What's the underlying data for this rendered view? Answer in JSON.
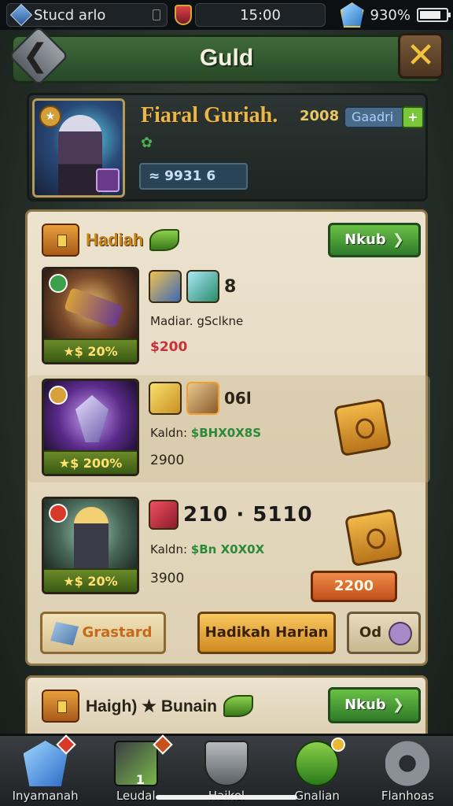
{
  "status_bar": {
    "left_text": "Stucd arlo",
    "time": "15:00",
    "battery_text": "930%",
    "battery_level_pct": 80
  },
  "header": {
    "title": "Guld",
    "back_icon": "chevron-left-icon",
    "close_icon": "close-icon"
  },
  "profile": {
    "name": "Fiaral Guriah.",
    "level": "2008",
    "level_pill": "Gaadri",
    "power": "≈ 9931 6"
  },
  "section1": {
    "title": "Hadiah",
    "button_label": "Nkub",
    "items": [
      {
        "price_label": "★$ 20%",
        "label_prefix": "Madiar.",
        "label_value": "gSclkne",
        "count": "8",
        "number": "$200",
        "number_color": "red"
      },
      {
        "price_label": "★$ 200%",
        "label_prefix": "Kaldn:",
        "label_value": "$BHX0X8S",
        "count": "06l",
        "number": "2900"
      },
      {
        "price_label": "★$ 20%",
        "label_prefix": "Kaldn:",
        "label_value": "$Bn X0X0X",
        "big_value": "210 · 5110",
        "number": "3900",
        "reward_price": "2200"
      }
    ],
    "actions": {
      "left": "Grastard",
      "center": "Hadikah Harian",
      "right": "Od"
    }
  },
  "section2": {
    "title": "Haigh) ★ Bunain",
    "button_label": "Nkub"
  },
  "bottom_nav": [
    {
      "label": "Inyamanah",
      "icon": "crystal-icon"
    },
    {
      "label": "Leudal",
      "icon": "sword-icon",
      "badge": "1"
    },
    {
      "label": "Haikel",
      "icon": "shield-icon"
    },
    {
      "label": "Gnalian",
      "icon": "leaf-icon"
    },
    {
      "label": "Flanhoas",
      "icon": "gear-icon"
    }
  ]
}
